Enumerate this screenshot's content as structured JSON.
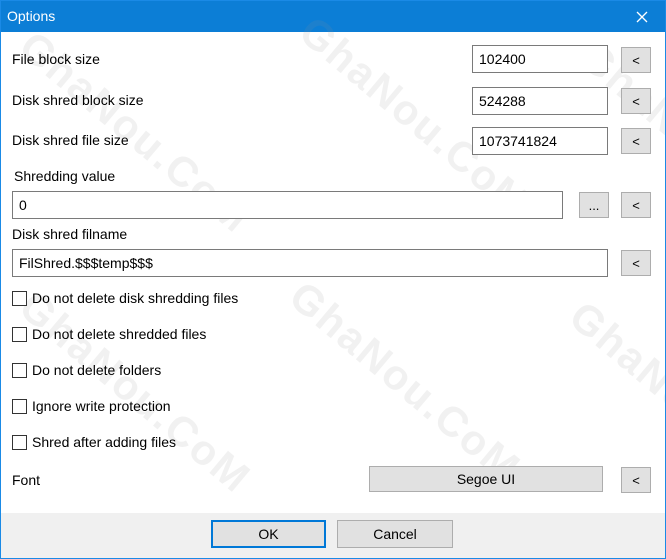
{
  "window": {
    "title": "Options"
  },
  "fields": {
    "file_block_size": {
      "label": "File block size",
      "value": "102400",
      "reset_label": "<"
    },
    "disk_shred_block_size": {
      "label": "Disk shred block size",
      "value": "524288",
      "reset_label": "<"
    },
    "disk_shred_file_size": {
      "label": "Disk shred file size",
      "value": "1073741824",
      "reset_label": "<"
    },
    "shredding_value": {
      "label": "Shredding value",
      "value": "0",
      "browse_label": "...",
      "reset_label": "<"
    },
    "disk_shred_filname": {
      "label": "Disk shred filname",
      "value": "FilShred.$$$temp$$$",
      "reset_label": "<"
    }
  },
  "checkboxes": [
    {
      "label": "Do not delete disk shredding files",
      "checked": false
    },
    {
      "label": "Do not delete shredded files",
      "checked": false
    },
    {
      "label": "Do not delete folders",
      "checked": false
    },
    {
      "label": "Ignore write protection",
      "checked": false
    },
    {
      "label": "Shred after adding files",
      "checked": false
    }
  ],
  "font": {
    "label": "Font",
    "value": "Segoe UI",
    "reset_label": "<"
  },
  "footer": {
    "ok_label": "OK",
    "cancel_label": "Cancel"
  },
  "watermark": "GhaNou.CoM",
  "colors": {
    "titlebar": "#0c7ed6",
    "footer": "#f0f0f0",
    "button": "#e1e1e1",
    "accent": "#0078d7"
  }
}
